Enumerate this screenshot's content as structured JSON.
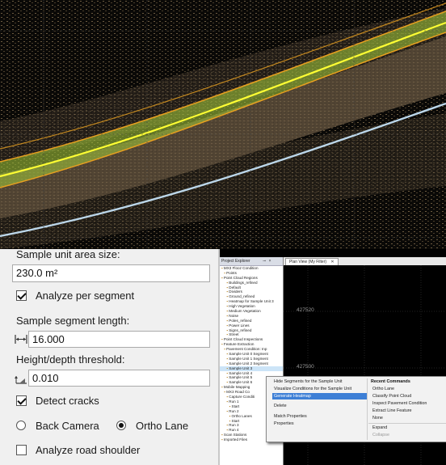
{
  "scene": {
    "description_colors": {
      "road": "#5e4f3a",
      "lane_overlay": "#9ec13a",
      "edge_line": "#ffff33",
      "boundary": "#e8a020",
      "shoulder_line": "#bcd7ea"
    }
  },
  "settings": {
    "area_label": "Sample unit area size:",
    "area_value": "230.0 m²",
    "analyze_per_segment": {
      "label": "Analyze per segment",
      "checked": true
    },
    "segment_length_label": "Sample segment length:",
    "segment_length_value": "16.000",
    "height_label": "Height/depth threshold:",
    "height_value": "0.010",
    "detect_cracks": {
      "label": "Detect cracks",
      "checked": true
    },
    "back_camera": {
      "label": "Back Camera",
      "selected": false
    },
    "ortho_lane": {
      "label": "Ortho Lane",
      "selected": true
    },
    "analyze_shoulder": {
      "label": "Analyze road shoulder",
      "checked": false
    }
  },
  "project_explorer": {
    "title": "Project Explorer",
    "items": [
      "MX3 Flooz Condition",
      "Points",
      "Point Cloud Regions",
      "Buildings_refined",
      "Default",
      "Dividers",
      "Ground_refined",
      "Heatmap for Sample Unit 3",
      "High Vegetation",
      "Medium Vegetation",
      "Noise",
      "Poles_refined",
      "Power Lines",
      "Signs_refined",
      "Street",
      "Point Cloud Inspections",
      "Feature Extraction",
      "Pavement Condition: Inp",
      "Sample Unit 0 Segment",
      "Sample Unit 1 Segment",
      "Sample Unit 2 Segment",
      "Sample Unit 3",
      "Sample Unit 4",
      "Sample Unit 5",
      "Sample Unit 6",
      "Mobile Mapping",
      "MX3 Road Co",
      "Capture Conditi",
      "Run 1",
      "Start",
      "Run 2",
      "Ortho Lanes",
      "Start",
      "Run 3",
      "Run 4",
      "Scan Stations",
      "Imported Files"
    ],
    "selected_index": 21
  },
  "plan_view": {
    "tab": "Plan View (My Filter)",
    "close": "✕",
    "coord1": "427520",
    "coord2": "427500"
  },
  "context_menu": {
    "left_items": [
      "Hide Segments for the Sample Unit",
      "Visualize Conditions for the Sample Unit",
      "Generate Heatmap",
      "Delete",
      "Match Properties",
      "Properties"
    ],
    "highlighted_index": 2,
    "recent_header": "Recent Commands",
    "recent_items": [
      "Ortho Lane",
      "Classify Point Cloud",
      "Inspect Pavement Condition",
      "Extract Line Feature",
      "None"
    ],
    "expand": "Expand",
    "collapse": "Collapse"
  }
}
